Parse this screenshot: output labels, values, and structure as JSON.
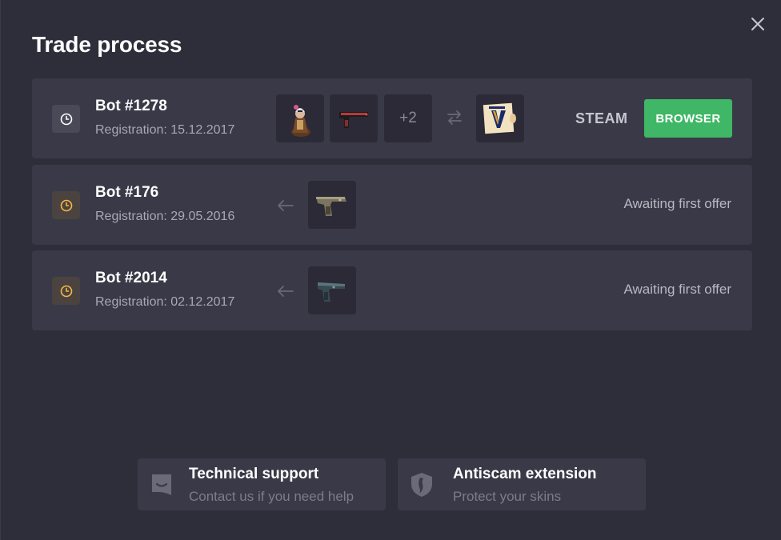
{
  "title": "Trade process",
  "rows": [
    {
      "bot_name": "Bot #1278",
      "registration": "Registration: 15.12.2017",
      "clock_color": "#ffffff",
      "items_extra": "+2",
      "platform": "STEAM",
      "action_label": "BROWSER"
    },
    {
      "bot_name": "Bot #176",
      "registration": "Registration: 29.05.2016",
      "clock_color": "#f5b942",
      "status": "Awaiting first offer"
    },
    {
      "bot_name": "Bot #2014",
      "registration": "Registration: 02.12.2017",
      "clock_color": "#f5b942",
      "status": "Awaiting first offer"
    }
  ],
  "footer": {
    "support": {
      "title": "Technical support",
      "subtitle": "Contact us if you need help"
    },
    "antiscam": {
      "title": "Antiscam extension",
      "subtitle": "Protect your skins"
    }
  },
  "colors": {
    "background": "#2e2d3a",
    "card": "#3a3947",
    "accent_green": "#3fb766",
    "pending_yellow": "#f5b942"
  },
  "icons": [
    "close-icon",
    "clock-icon",
    "swap-icon",
    "arrow-left-icon",
    "chat-icon",
    "shield-icon"
  ]
}
